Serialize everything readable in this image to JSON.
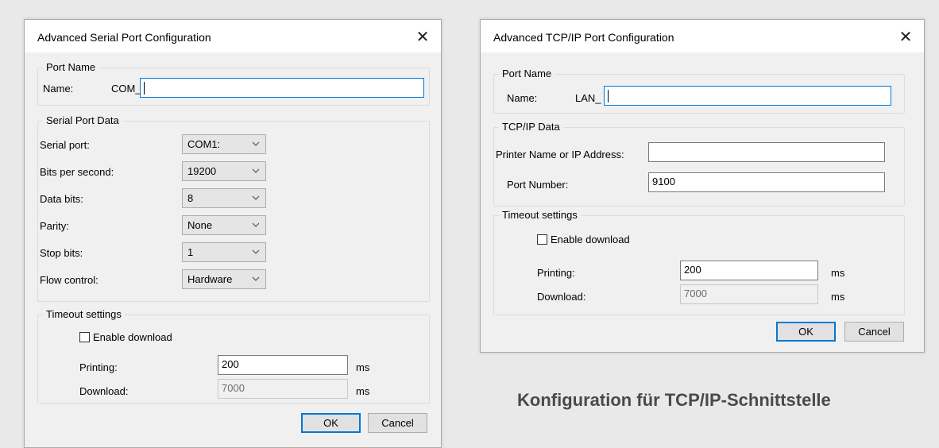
{
  "serial": {
    "title": "Advanced Serial Port Configuration",
    "close": "✕",
    "port_name": {
      "legend": "Port Name",
      "name_label": "Name:",
      "prefix": "COM_",
      "value": ""
    },
    "serial_data": {
      "legend": "Serial Port Data",
      "fields": [
        {
          "label": "Serial port:",
          "value": "COM1:"
        },
        {
          "label": "Bits per second:",
          "value": "19200"
        },
        {
          "label": "Data bits:",
          "value": "8"
        },
        {
          "label": "Parity:",
          "value": "None"
        },
        {
          "label": "Stop bits:",
          "value": "1"
        },
        {
          "label": "Flow control:",
          "value": "Hardware"
        }
      ]
    },
    "timeout": {
      "legend": "Timeout settings",
      "enable_download": "Enable download",
      "enable_download_checked": false,
      "printing_label": "Printing:",
      "printing_value": "200",
      "download_label": "Download:",
      "download_value": "7000",
      "unit": "ms"
    },
    "buttons": {
      "ok": "OK",
      "cancel": "Cancel"
    }
  },
  "tcp": {
    "title": "Advanced TCP/IP Port Configuration",
    "close": "✕",
    "port_name": {
      "legend": "Port Name",
      "name_label": "Name:",
      "prefix": "LAN_",
      "value": ""
    },
    "tcp_data": {
      "legend": "TCP/IP Data",
      "printer_label": "Printer Name or IP Address:",
      "printer_value": "",
      "port_label": "Port Number:",
      "port_value": "9100"
    },
    "timeout": {
      "legend": "Timeout settings",
      "enable_download": "Enable download",
      "enable_download_checked": false,
      "printing_label": "Printing:",
      "printing_value": "200",
      "download_label": "Download:",
      "download_value": "7000",
      "unit": "ms"
    },
    "buttons": {
      "ok": "OK",
      "cancel": "Cancel"
    }
  },
  "caption": "Konfiguration für TCP/IP-Schnittstelle",
  "colors": {
    "accent": "#0078d7",
    "caption": "#4a4a4a"
  }
}
